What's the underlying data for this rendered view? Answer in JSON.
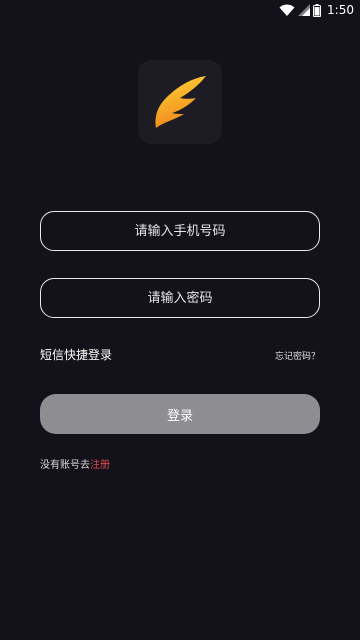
{
  "status_bar": {
    "time": "1:50",
    "icons": [
      "wifi-icon",
      "cell-signal-icon",
      "battery-icon"
    ]
  },
  "logo": {
    "icon": "wing-logo-icon",
    "colors": {
      "tile": "#1d1c24",
      "gradient_top": "#ffd23a",
      "gradient_bottom": "#f28a1c"
    }
  },
  "form": {
    "phone_placeholder": "请输入手机号码",
    "phone_value": "",
    "password_placeholder": "请输入密码",
    "password_value": ""
  },
  "links": {
    "sms_login": "短信快捷登录",
    "forgot_password": "忘记密码？"
  },
  "login_button": {
    "label": "登录",
    "color": "#8e8d92"
  },
  "register": {
    "prompt": "没有账号去",
    "link": "注册",
    "link_color": "#e0484f"
  },
  "theme": {
    "background": "#13121a"
  }
}
